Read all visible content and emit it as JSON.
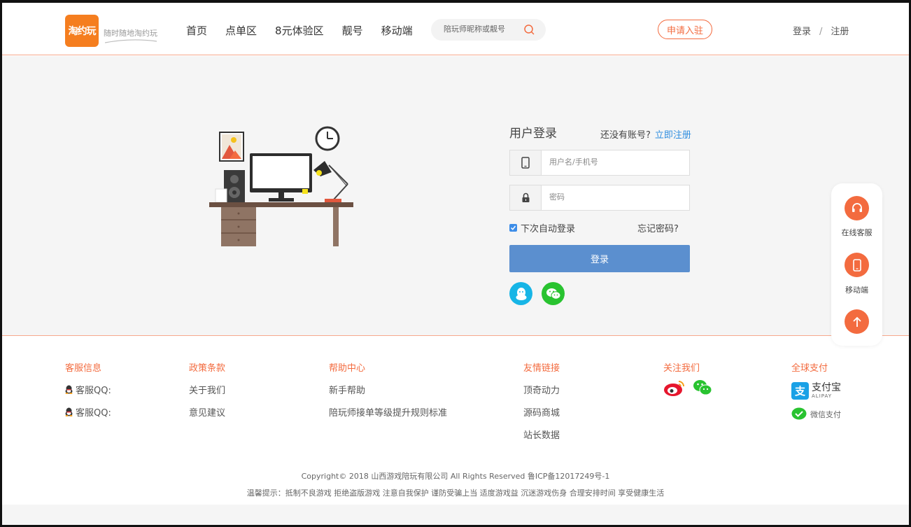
{
  "header": {
    "logo_text": "淘约玩",
    "slogan": "随时随地淘约玩",
    "nav": [
      "首页",
      "点单区",
      "8元体验区",
      "靓号",
      "移动端"
    ],
    "search_placeholder": "陪玩师昵称或靓号",
    "apply_label": "申请入驻",
    "login_label": "登录",
    "separator": "/",
    "register_label": "注册"
  },
  "login": {
    "title": "用户登录",
    "no_account": "还没有账号?",
    "register_now": "立即注册",
    "username_placeholder": "用户名/手机号",
    "password_placeholder": "密码",
    "remember_label": "下次自动登录",
    "remember_checked": true,
    "forgot_label": "忘记密码?",
    "submit_label": "登录"
  },
  "side_widget": {
    "online_service": "在线客服",
    "mobile": "移动端"
  },
  "footer": {
    "columns": {
      "service": {
        "title": "客服信息",
        "items": [
          "客服QQ:",
          "客服QQ:"
        ]
      },
      "policy": {
        "title": "政策条款",
        "items": [
          "关于我们",
          "意见建议"
        ]
      },
      "help": {
        "title": "帮助中心",
        "items": [
          "新手帮助",
          "陪玩师接单等级提升规则标准"
        ]
      },
      "links": {
        "title": "友情链接",
        "items": [
          "顶奇动力",
          "源码商城",
          "站长数据"
        ]
      },
      "follow": {
        "title": "关注我们"
      },
      "payment": {
        "title": "全球支付",
        "alipay": "支付宝",
        "alipay_en": "ALIPAY",
        "wechat_pay": "微信支付"
      }
    },
    "copyright": "Copyright© 2018 山西游戏陪玩有限公司 All Rights Reserved 鲁ICP备12017249号-1",
    "tips": "温馨提示：抵制不良游戏 拒绝盗版游戏 注意自我保护 谨防受骗上当 适度游戏益 沉迷游戏伤身 合理安排时间 享受健康生活"
  },
  "colors": {
    "accent": "#f36b3f",
    "login_button": "#5b8fcf",
    "link_blue": "#2f8ee0",
    "qq": "#17b5e6",
    "wechat": "#29c330"
  },
  "icons": [
    "search-icon",
    "phone-icon",
    "lock-icon",
    "qq-icon",
    "wechat-icon",
    "headset-icon",
    "mobile-icon",
    "arrow-up-icon",
    "weibo-icon",
    "alipay-icon",
    "wechat-pay-icon",
    "penguin-icon"
  ]
}
